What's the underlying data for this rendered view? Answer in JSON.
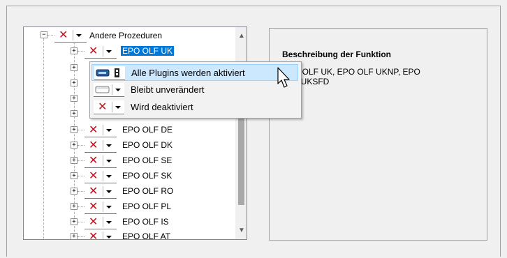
{
  "tree": {
    "root": {
      "label": "Andere Prozeduren",
      "state_icon": "red-x-icon"
    },
    "selected": {
      "label": "EPO OLF UK"
    },
    "items": [
      {
        "label": "EPO OLF DE"
      },
      {
        "label": "EPO OLF DK"
      },
      {
        "label": "EPO OLF SE"
      },
      {
        "label": "EPO OLF SK"
      },
      {
        "label": "EPO OLF RO"
      },
      {
        "label": "EPO OLF PL"
      },
      {
        "label": "EPO OLF IS"
      },
      {
        "label": "EPO OLF AT"
      }
    ],
    "expander_glyph": "+",
    "root_expander_glyph": "−",
    "x_glyph": "✕"
  },
  "context_menu": {
    "items": [
      {
        "label": "Alle Plugins werden aktiviert",
        "icon": "plugin-on-icon"
      },
      {
        "label": "Bleibt unverändert",
        "icon": "plugin-unchanged-icon"
      },
      {
        "label": "Wird deaktiviert",
        "icon": "red-x-icon"
      }
    ]
  },
  "description": {
    "title": "Beschreibung der Funktion",
    "text_line1": "EPO OLF UK, EPO OLF UKNP, EPO",
    "text_line2": "OLF UKSFD"
  },
  "scrollbar": {
    "up": "▲",
    "down": "▼"
  },
  "colors": {
    "selection": "#0078d7",
    "menu_highlight": "#cce8ff",
    "x_red": "#c0121b"
  }
}
